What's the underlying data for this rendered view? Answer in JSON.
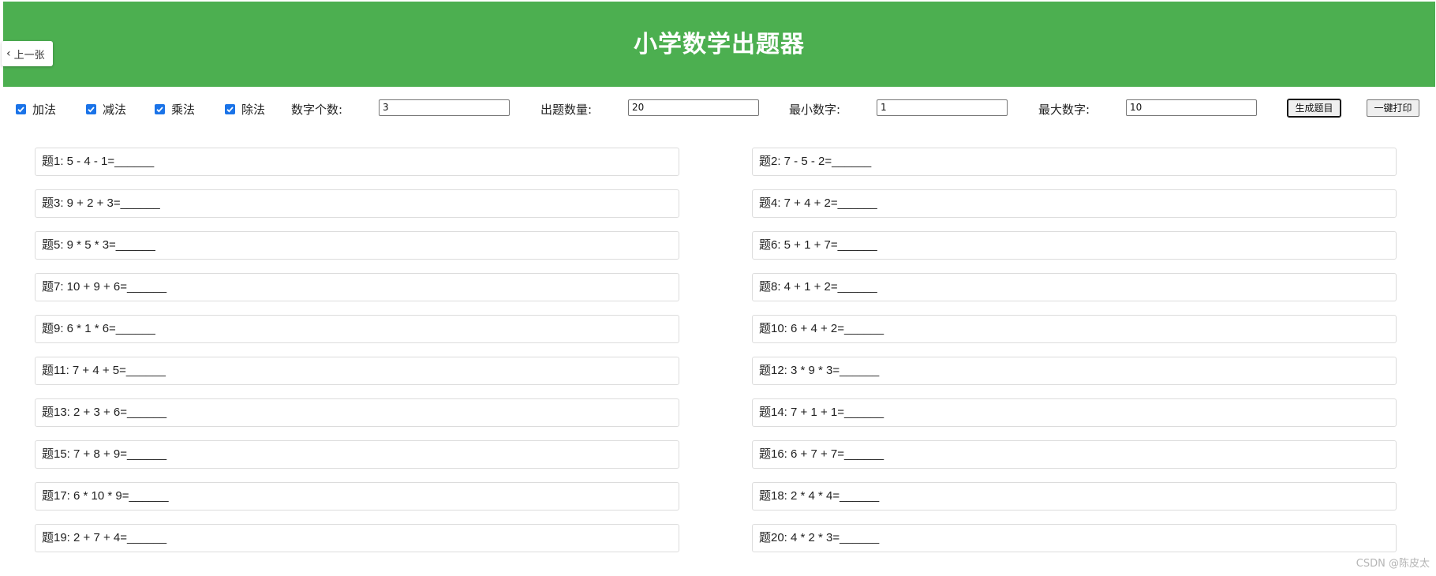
{
  "header": {
    "title": "小学数学出题器",
    "back_label": "上一张",
    "bg_color": "#4caf50"
  },
  "toolbar": {
    "ops": [
      {
        "label": "加法",
        "checked": true
      },
      {
        "label": "减法",
        "checked": true
      },
      {
        "label": "乘法",
        "checked": true
      },
      {
        "label": "除法",
        "checked": true
      }
    ],
    "num_count_label": "数字个数:",
    "num_count_value": "3",
    "question_count_label": "出题数量:",
    "question_count_value": "20",
    "min_label": "最小数字:",
    "min_value": "1",
    "max_label": "最大数字:",
    "max_value": "10",
    "generate_label": "生成题目",
    "print_label": "一键打印"
  },
  "questions": [
    "题1: 5 - 4 - 1=______",
    "题2: 7 - 5 - 2=______",
    "题3: 9 + 2 + 3=______",
    "题4: 7 + 4 + 2=______",
    "题5: 9 * 5 * 3=______",
    "题6: 5 + 1 + 7=______",
    "题7: 10 + 9 + 6=______",
    "题8: 4 + 1 + 2=______",
    "题9: 6 * 1 * 6=______",
    "题10: 6 + 4 + 2=______",
    "题11: 7 + 4 + 5=______",
    "题12: 3 * 9 * 3=______",
    "题13: 2 + 3 + 6=______",
    "题14: 7 + 1 + 1=______",
    "题15: 7 + 8 + 9=______",
    "题16: 6 + 7 + 7=______",
    "题17: 6 * 10 * 9=______",
    "题18: 2 * 4 * 4=______",
    "题19: 2 + 7 + 4=______",
    "题20: 4 * 2 * 3=______"
  ],
  "watermark": "CSDN @陈皮太"
}
